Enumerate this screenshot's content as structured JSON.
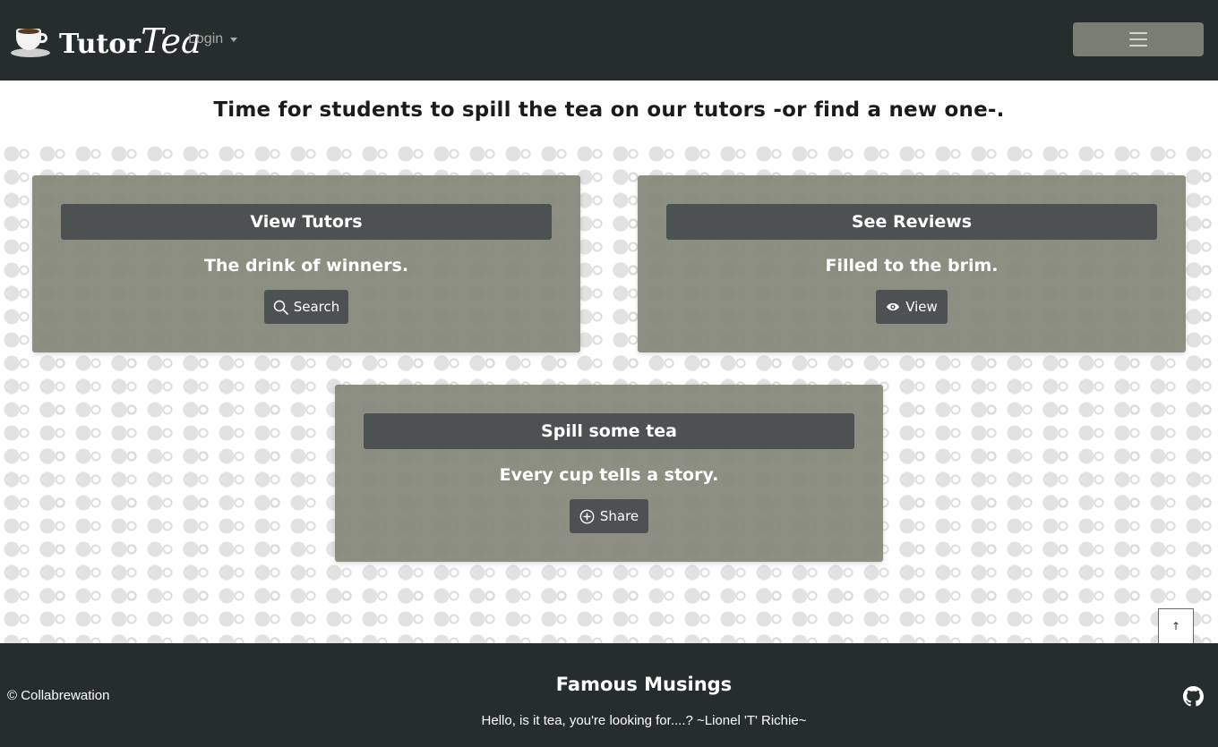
{
  "navbar": {
    "brand_main": "Tutor",
    "brand_accent": "Tea",
    "login_label": "Login",
    "colors": {
      "background": "#262d2d",
      "toggler": "#7b7e72"
    },
    "icons": {
      "brand": "coffee-cup-icon",
      "menu": "hamburger-menu-icon",
      "caret": "caret-down-icon"
    }
  },
  "tagline": "Time for students to spill the tea on our tutors -or find a new one-.",
  "cards": {
    "tutors": {
      "title": "View Tutors",
      "text": "The drink of winners.",
      "button_label": "Search",
      "icon": "search-icon"
    },
    "reviews": {
      "title": "See Reviews",
      "text": "Filled to the brim.",
      "button_label": "View",
      "icon": "eye-icon"
    },
    "spill": {
      "title": "Spill some tea",
      "text": "Every cup tells a story.",
      "button_label": "Share",
      "icon": "plus-circle-icon"
    }
  },
  "back_to_top": "↑",
  "footer": {
    "copyright": "© Collabrewation",
    "musings_title": "Famous Musings",
    "musings_quote": "Hello, is it tea, you're looking for....? ~Lionel 'T' Richie~",
    "icon": "github-icon"
  }
}
